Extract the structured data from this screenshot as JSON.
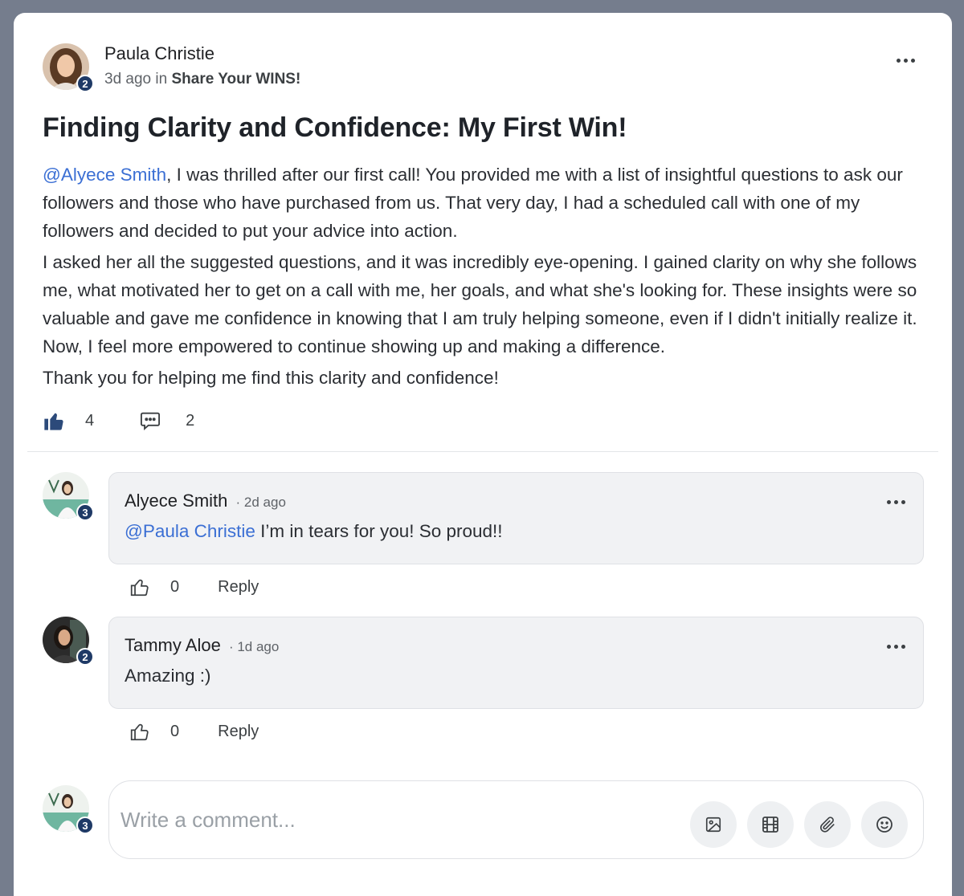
{
  "post": {
    "author": "Paula Christie",
    "author_badge": "2",
    "time": "3d ago",
    "in_word": "in",
    "group": "Share Your WINS!",
    "title": "Finding Clarity and Confidence: My First Win!",
    "body_mention": "@Alyece Smith",
    "body_p1_rest": ", I was thrilled after our first call! You provided me with a list of insightful questions to ask our followers and those who have purchased from us. That very day, I had a scheduled call with one of my followers and decided to put your advice into action.",
    "body_p2": "I asked her all the suggested questions, and it was incredibly eye-opening. I gained clarity on why she follows me, what motivated her to get on a call with me, her goals, and what she's looking for. These insights were so valuable and gave me confidence in knowing that I am truly helping someone, even if I didn't initially realize it. Now, I feel more empowered to continue showing up and making a difference.",
    "body_p3": "Thank you for helping me find this clarity and confidence!",
    "likes": "4",
    "comments": "2"
  },
  "comments": [
    {
      "author": "Alyece Smith",
      "badge": "3",
      "time": "· 2d ago",
      "mention": "@Paula Christie",
      "text": " I’m in tears for you! So proud!!",
      "likes": "0",
      "reply_label": "Reply"
    },
    {
      "author": "Tammy Aloe",
      "badge": "2",
      "time": "· 1d ago",
      "text": "Amazing :)",
      "likes": "0",
      "reply_label": "Reply"
    }
  ],
  "composer": {
    "badge": "3",
    "placeholder": "Write a comment..."
  },
  "icons": {
    "like_filled": "thumbs-up-filled-icon",
    "comment": "comment-bubble-icon",
    "like_outline": "thumbs-up-outline-icon",
    "more": "more-horizontal-icon",
    "image": "image-icon",
    "video": "film-icon",
    "attach": "paperclip-icon",
    "emoji": "emoji-icon"
  },
  "colors": {
    "accent": "#3b6fd4",
    "badge": "#1f3a66",
    "like_active": "#2c4a7a"
  }
}
